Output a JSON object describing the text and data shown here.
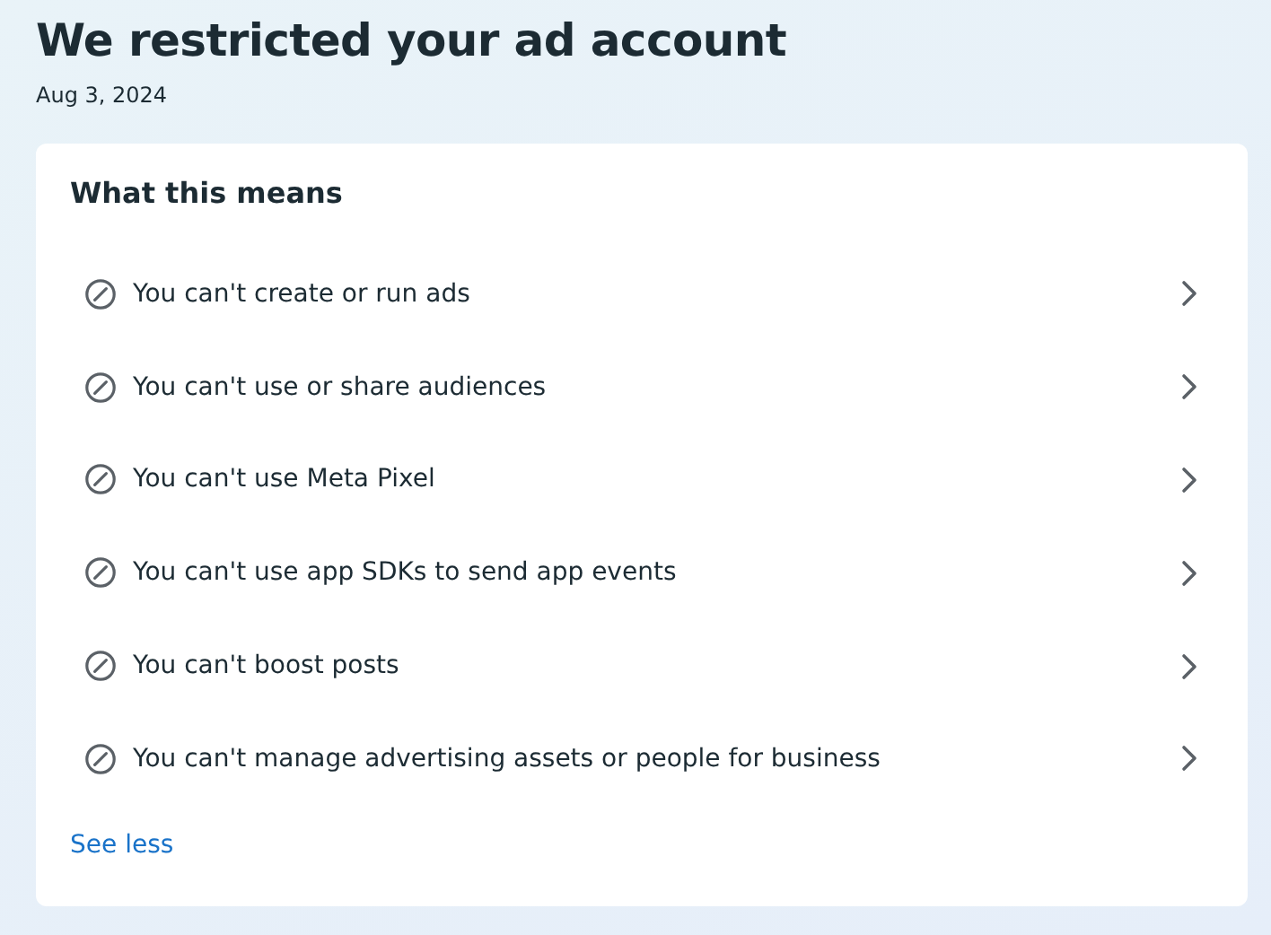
{
  "header": {
    "title": "We restricted your ad account",
    "date": "Aug 3, 2024"
  },
  "card": {
    "heading": "What this means",
    "items": [
      {
        "label": "You can't create or run ads"
      },
      {
        "label": "You can't use or share audiences"
      },
      {
        "label": "You can't use Meta Pixel"
      },
      {
        "label": "You can't use app SDKs to send app events"
      },
      {
        "label": "You can't boost posts"
      },
      {
        "label": "You can't manage advertising assets or people for business"
      }
    ],
    "link": "See less"
  }
}
